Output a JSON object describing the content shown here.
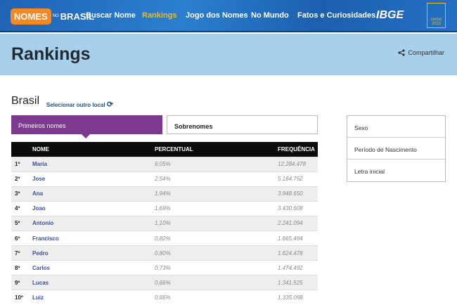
{
  "header": {
    "logo_main": "NOMES",
    "logo_no": "NO",
    "logo_brasil": "BRASIL",
    "nav": [
      "Buscar Nome",
      "Rankings",
      "Jogo dos Nomes",
      "No Mundo",
      "Fatos e Curiosidades"
    ],
    "ibge": "IBGE",
    "censo": "censo 2022"
  },
  "page": {
    "title": "Rankings",
    "share": "Compartilhar",
    "location": "Brasil",
    "select_location": "Selecionar outro local"
  },
  "tabs": [
    "Primeiros nomes",
    "Sobrenomes"
  ],
  "table": {
    "headers": [
      "",
      "NOME",
      "PERCENTUAL",
      "FREQUÊNCIA"
    ],
    "rows": [
      [
        "1º",
        "Maria",
        "6,05%",
        "12.284.478"
      ],
      [
        "2º",
        "Jose",
        "2,54%",
        "5.164.752"
      ],
      [
        "3º",
        "Ana",
        "1,94%",
        "3.948.650"
      ],
      [
        "4º",
        "Joao",
        "1,69%",
        "3.430.608"
      ],
      [
        "5º",
        "Antonio",
        "1,10%",
        "2.241.094"
      ],
      [
        "6º",
        "Francisco",
        "0,82%",
        "1.665.494"
      ],
      [
        "7º",
        "Pedro",
        "0,80%",
        "1.624.478"
      ],
      [
        "8º",
        "Carlos",
        "0,73%",
        "1.474.492"
      ],
      [
        "9º",
        "Lucas",
        "0,66%",
        "1.341.525"
      ],
      [
        "10º",
        "Luiz",
        "0,66%",
        "1.335.098"
      ]
    ]
  },
  "filters": [
    "Sexo",
    "Período de Nascimento",
    "Letra inicial"
  ]
}
